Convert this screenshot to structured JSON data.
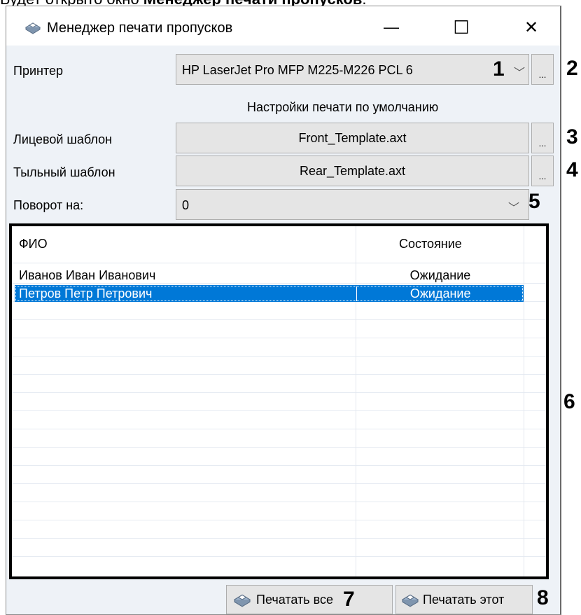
{
  "caption": {
    "prefix": "Будет открыто окно ",
    "bold": "Менеджер печати пропусков",
    "suffix": "."
  },
  "window": {
    "title": "Менеджер печати пропусков",
    "icon": "printer-icon",
    "controls": {
      "minimize": "—",
      "maximize": "☐",
      "close": "✕"
    }
  },
  "form": {
    "printer_label": "Принтер",
    "printer_value": "HP LaserJet Pro MFP M225-M226 PCL 6",
    "defaults_text": "Настройки печати по умолчанию",
    "front_label": "Лицевой шаблон",
    "front_value": "Front_Template.axt",
    "rear_label": "Тыльный шаблон",
    "rear_value": "Rear_Template.axt",
    "rotate_label": "Поворот на:",
    "rotate_value": "0",
    "browse": "..."
  },
  "grid": {
    "columns": [
      "ФИО",
      "Состояние"
    ],
    "rows": [
      {
        "name": "Иванов Иван Иванович",
        "status": "Ожидание",
        "selected": false
      },
      {
        "name": "Петров Петр Петрович",
        "status": "Ожидание",
        "selected": true
      }
    ]
  },
  "buttons": {
    "print_all": "Печатать все",
    "print_this": "Печатать этот"
  },
  "markers": [
    "1",
    "2",
    "3",
    "4",
    "5",
    "6",
    "7",
    "8"
  ],
  "colors": {
    "selection": "#0078d7",
    "window_bg": "#eef2f7",
    "control_bg": "#e5e5e5"
  }
}
